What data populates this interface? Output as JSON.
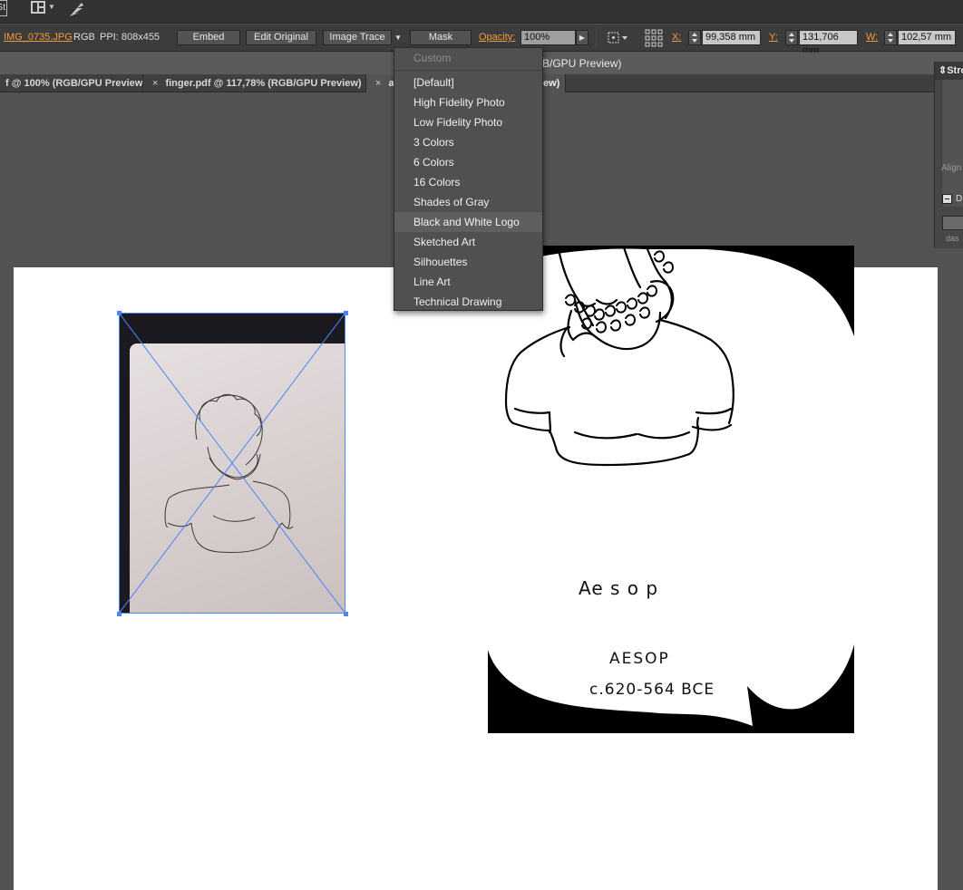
{
  "app_logo": "St",
  "document": {
    "filename": "IMG_0735.JPG",
    "color_mode": "RGB",
    "ppi": "PPI: 808x455",
    "title": "B/GPU Preview)"
  },
  "controlbar": {
    "embed_label": "Embed",
    "edit_original_label": "Edit Original",
    "image_trace_label": "Image Trace",
    "mask_label": "Mask",
    "opacity_label": "Opacity:",
    "opacity_value": "100%",
    "x_label": "X:",
    "x_value": "99,358 mm",
    "y_label": "Y:",
    "y_value": "131,706 mm",
    "w_label": "W:",
    "w_value": "102,57 mm"
  },
  "tabs": [
    {
      "label": "f @ 100% (RGB/GPU Preview)",
      "close": ""
    },
    {
      "label": "finger.pdf @ 117,78% (RGB/GPU Preview)",
      "close": "×"
    },
    {
      "label": "a",
      "close": "×"
    },
    {
      "label": "ew)",
      "close": ""
    }
  ],
  "trace_menu": {
    "items": [
      {
        "label": "Custom",
        "state": "disabled"
      },
      {
        "label": "[Default]",
        "state": "normal"
      },
      {
        "label": "High Fidelity Photo",
        "state": "normal"
      },
      {
        "label": "Low Fidelity Photo",
        "state": "normal"
      },
      {
        "label": "3 Colors",
        "state": "normal"
      },
      {
        "label": "6 Colors",
        "state": "normal"
      },
      {
        "label": "16 Colors",
        "state": "normal"
      },
      {
        "label": "Shades of Gray",
        "state": "normal"
      },
      {
        "label": "Black and White Logo",
        "state": "hover"
      },
      {
        "label": "Sketched Art",
        "state": "normal"
      },
      {
        "label": "Silhouettes",
        "state": "normal"
      },
      {
        "label": "Line Art",
        "state": "normal"
      },
      {
        "label": "Technical Drawing",
        "state": "normal"
      }
    ]
  },
  "stroke_panel": {
    "title": "Stro",
    "align_label": "Align",
    "dashed_label": "D",
    "dash_label": "das"
  },
  "artwork": {
    "handwritten_name": "Ae s o p",
    "caps_name": "AESOP",
    "dates": "c.620-564 BCE"
  },
  "colors": {
    "accent": "#f29c3d",
    "selection": "#4e83ff",
    "menu_bg": "#505050",
    "menu_hover": "#5f5f5f"
  }
}
